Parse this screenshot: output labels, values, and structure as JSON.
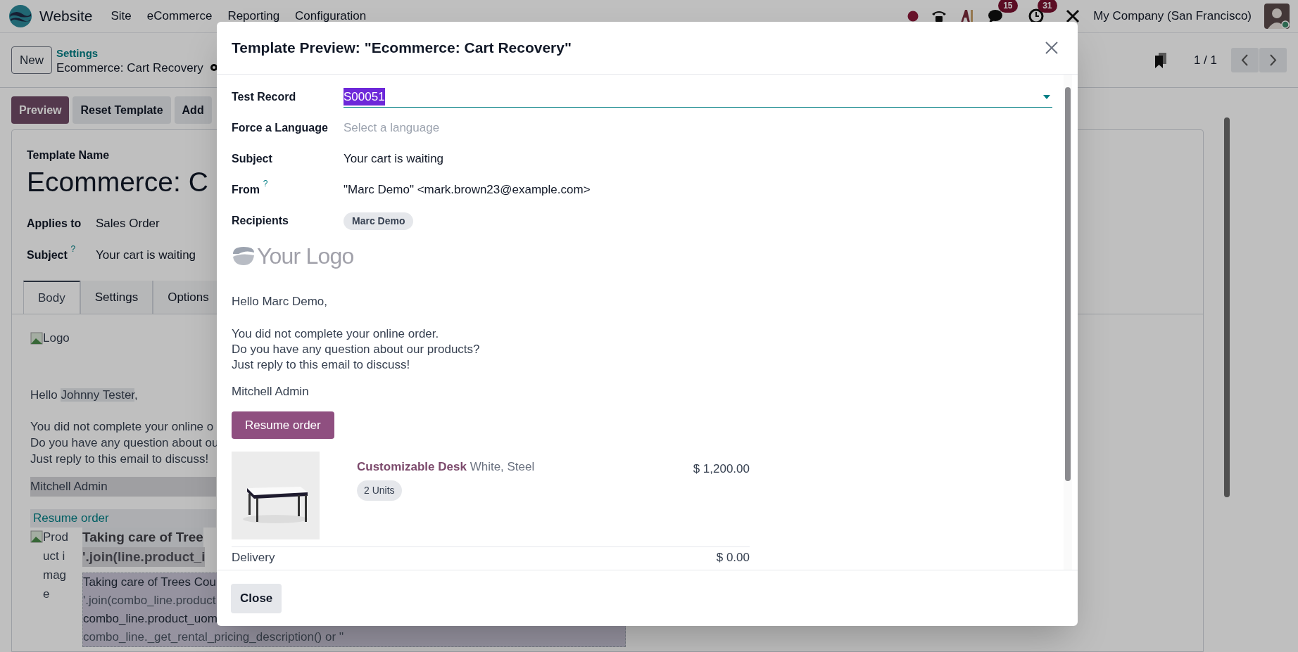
{
  "navbar": {
    "app": "Website",
    "menus": [
      "Site",
      "eCommerce",
      "Reporting",
      "Configuration"
    ],
    "chat_count": "15",
    "activity_count": "31",
    "company": "My Company (San Francisco)"
  },
  "control_panel": {
    "new_button": "New",
    "breadcrumb_parent": "Settings",
    "breadcrumb_current": "Ecommerce: Cart Recovery",
    "pager": "1 / 1"
  },
  "actions": [
    {
      "label": "Preview",
      "kind": "primary"
    },
    {
      "label": "Reset Template",
      "kind": "secondary"
    },
    {
      "label": "Add",
      "kind": "secondary"
    }
  ],
  "form": {
    "name_label": "Template Name",
    "name": "Ecommerce: C",
    "fields": [
      {
        "label": "Applies to",
        "value": "Sales Order"
      },
      {
        "label": "Subject",
        "tooltip": "?",
        "value": "Your cart is waiting"
      }
    ],
    "tabs": [
      {
        "label": "Body",
        "selected": true
      },
      {
        "label": "Settings",
        "selected": false
      },
      {
        "label": "Options",
        "selected": false
      }
    ],
    "body": {
      "logo_alt": "Logo",
      "greeting": {
        "prefix": "Hello ",
        "name": "Johnny Tester",
        "suffix": ","
      },
      "paragraph": [
        "You did not complete your online o",
        "Do you have any question about ou",
        "Just reply to this email to discuss!"
      ],
      "signature": "Mitchell Admin",
      "link": "Resume order",
      "image_alt": "Product image",
      "product_title": [
        "Taking care of Tree",
        "'.join(line.product_i"
      ],
      "combo_lines": [
        "Taking care of Trees Cou",
        "'.join(combo_line.product",
        "combo_line.product_uom",
        "combo_line._get_rental_pricing_description() or ''"
      ]
    }
  },
  "dialog": {
    "title": "Template Preview: \"Ecommerce: Cart Recovery\"",
    "fields": [
      {
        "kind": "select",
        "label": "Test Record",
        "value": "S00051",
        "focused": true,
        "highlighted": true
      },
      {
        "kind": "select",
        "label": "Force a Language",
        "placeholder": "Select a language",
        "focused": false
      },
      {
        "kind": "text",
        "label": "Subject",
        "value": "Your cart is waiting"
      },
      {
        "kind": "text",
        "label": "From",
        "tooltip": "?",
        "value": "\"Marc Demo\" <mark.brown23@example.com>"
      },
      {
        "kind": "tags",
        "label": "Recipients",
        "tags": [
          "Marc Demo"
        ]
      }
    ],
    "logo": "Your Logo",
    "greeting": "Hello Marc Demo,",
    "paragraph": [
      "You did not complete your online order.",
      "Do you have any question about our products?",
      "Just reply to this email to discuss!"
    ],
    "signature": "Mitchell Admin",
    "button": "Resume order",
    "lines": [
      {
        "product": "Customizable Desk",
        "variant": "White, Steel",
        "quantity": "2 Units",
        "price": "$ 1,200.00"
      }
    ],
    "delivery": {
      "label": "Delivery",
      "amount": "$ 0.00"
    },
    "close": "Close"
  }
}
